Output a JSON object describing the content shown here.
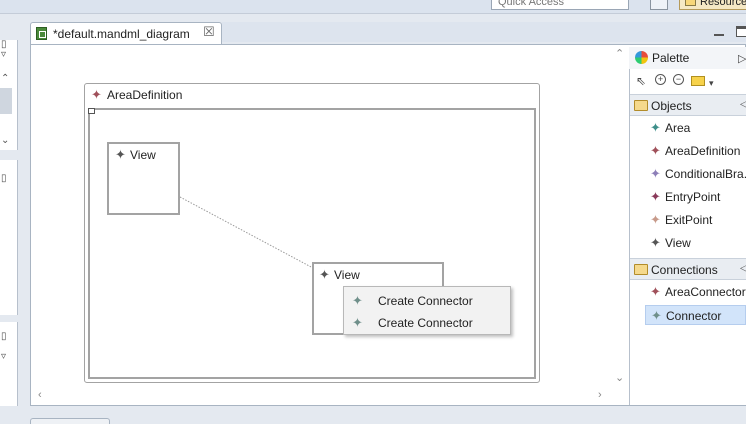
{
  "toolbar": {
    "quick_access_placeholder": "Quick Access",
    "resource_label": "Resource"
  },
  "editor_tab": {
    "title": "*default.mandml_diagram",
    "close_glyph": "☒"
  },
  "diagram": {
    "area": {
      "label": "AreaDefinition"
    },
    "views": [
      {
        "label": "View"
      },
      {
        "label": "View"
      }
    ]
  },
  "context_menu": {
    "items": [
      {
        "label": "Create Connector"
      },
      {
        "label": "Create Connector"
      }
    ]
  },
  "palette": {
    "title": "Palette",
    "drawers": {
      "objects": {
        "label": "Objects",
        "items": [
          {
            "label": "Area",
            "color": "#3e8f8a"
          },
          {
            "label": "AreaDefinition",
            "color": "#a0505a"
          },
          {
            "label": "ConditionalBra...",
            "color": "#8d7fb8"
          },
          {
            "label": "EntryPoint",
            "color": "#8a3a5a"
          },
          {
            "label": "ExitPoint",
            "color": "#c79a8a"
          },
          {
            "label": "View",
            "color": "#555555"
          }
        ]
      },
      "connections": {
        "label": "Connections",
        "items": [
          {
            "label": "AreaConnector",
            "color": "#a0505a"
          },
          {
            "label": "Connector",
            "color": "#6f8f8a",
            "selected": true
          }
        ]
      }
    }
  },
  "colors": {
    "diagram_border": "#a3a3a3",
    "selection_bg": "#d2e4fa",
    "tab_border": "#a8b4c2"
  },
  "icons": {
    "element_icon": "four-point-star-icon",
    "folder": "folder-icon",
    "palette": "palette-icon"
  }
}
